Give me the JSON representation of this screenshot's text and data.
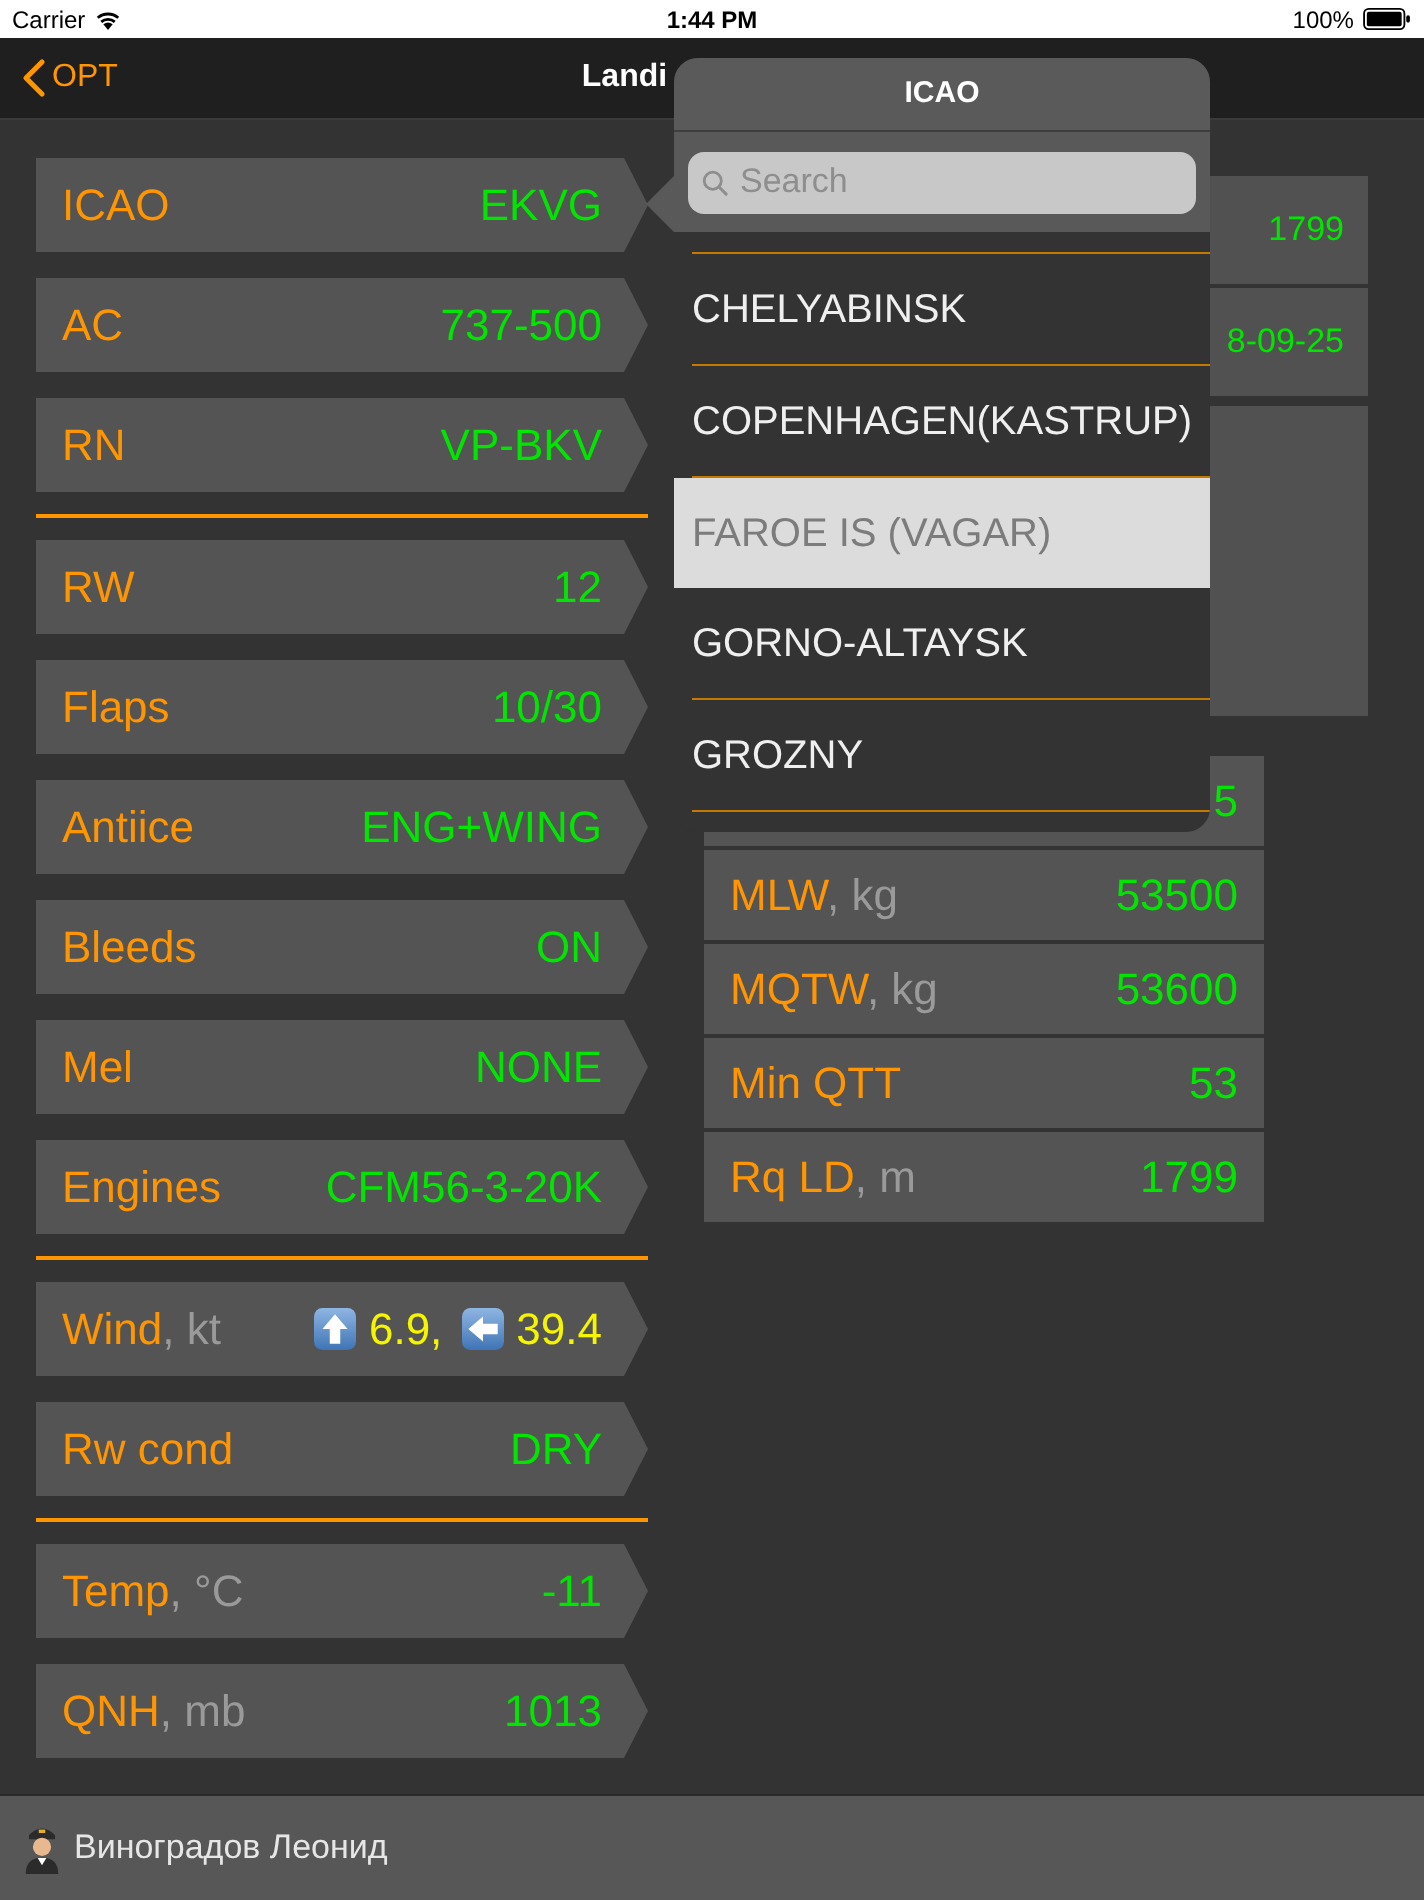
{
  "status_bar": {
    "carrier": "Carrier",
    "time": "1:44 PM",
    "battery": "100%"
  },
  "nav_bar": {
    "back": "OPT",
    "title": "Landi"
  },
  "parameters": [
    {
      "rows": [
        {
          "kind": "text",
          "label": "ICAO",
          "value": "EKVG",
          "color": "#00e600"
        },
        {
          "kind": "text",
          "label": "AC",
          "value": "737-500",
          "color": "#00e600"
        },
        {
          "kind": "text",
          "label": "RN",
          "value": "VP-BKV",
          "color": "#00e600"
        }
      ]
    },
    {
      "rows": [
        {
          "kind": "text",
          "label": "RW",
          "value": "12",
          "color": "#00e600"
        },
        {
          "kind": "text",
          "label": "Flaps",
          "value": "10/30",
          "color": "#00e600"
        },
        {
          "kind": "text",
          "label": "Antiice",
          "value": "ENG+WING",
          "color": "#00e600"
        },
        {
          "kind": "text",
          "label": "Bleeds",
          "value": "ON",
          "color": "#00e600"
        },
        {
          "kind": "text",
          "label": "Mel",
          "value": "NONE",
          "color": "#00e600"
        },
        {
          "kind": "text",
          "label": "Engines",
          "value": "CFM56-3-20K",
          "color": "#00e600"
        }
      ]
    },
    {
      "rows": [
        {
          "kind": "wind",
          "label": "Wind",
          "unit": ", kt",
          "color": "#f5f500",
          "parts": [
            {
              "kind": "head",
              "text": "6.9,"
            },
            {
              "kind": "cross",
              "text": "39.4"
            }
          ]
        },
        {
          "kind": "text",
          "label": "Rw cond",
          "value": "DRY",
          "color": "#00e600"
        }
      ]
    },
    {
      "rows": [
        {
          "kind": "text",
          "label": "Temp",
          "unit": ", °C",
          "value": "-11",
          "color": "#00e600"
        },
        {
          "kind": "text",
          "label": "QNH",
          "unit": ", mb",
          "value": "1013",
          "color": "#00e600"
        }
      ]
    }
  ],
  "results": {
    "card": [
      "1799",
      "8-09-25"
    ],
    "limits": [
      {
        "value": "5"
      },
      {
        "label": "MLW",
        "unit": ", kg",
        "value": "53500"
      },
      {
        "label": "MQTW",
        "unit": ", kg",
        "value": "53600"
      },
      {
        "label": "Min QTT",
        "value": "53"
      },
      {
        "label": "Rq LD",
        "unit": ", m",
        "value": "1799"
      }
    ]
  },
  "popover": {
    "title": "ICAO",
    "search": {
      "placeholder": "Search"
    },
    "items": [
      {
        "label": "CHELYABINSK",
        "selected": false
      },
      {
        "label": "COPENHAGEN(KASTRUP)",
        "selected": false
      },
      {
        "label": "FAROE IS (VAGAR)",
        "selected": true
      },
      {
        "label": "GORNO-ALTAYSK",
        "selected": false
      },
      {
        "label": "GROZNY",
        "selected": false
      }
    ]
  },
  "user": {
    "name": "Виноградов Леонид"
  }
}
